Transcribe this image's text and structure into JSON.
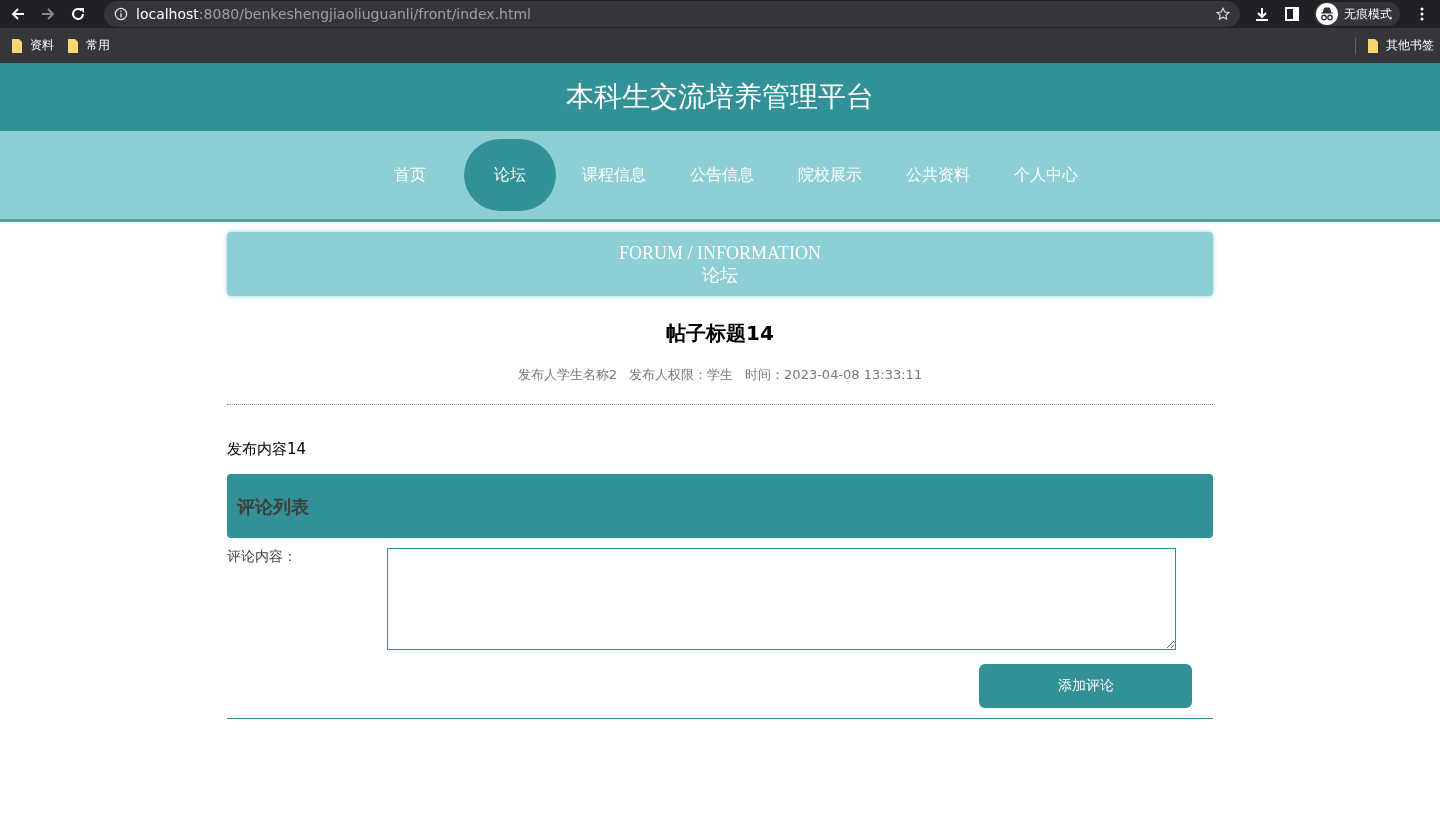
{
  "browser": {
    "url_host": "localhost",
    "url_path": ":8080/benkeshengjiaoliuguanli/front/index.html",
    "profile_label": "无痕模式",
    "bookmarks": [
      "资料",
      "常用"
    ],
    "other_bookmarks": "其他书签"
  },
  "site": {
    "title": "本科生交流培养管理平台"
  },
  "nav": [
    {
      "label": "首页",
      "selected": false
    },
    {
      "label": "论坛",
      "selected": true
    },
    {
      "label": "课程信息",
      "selected": false
    },
    {
      "label": "公告信息",
      "selected": false
    },
    {
      "label": "院校展示",
      "selected": false
    },
    {
      "label": "公共资料",
      "selected": false
    },
    {
      "label": "个人中心",
      "selected": false
    }
  ],
  "banner": {
    "subtitle_en": "FORUM / INFORMATION",
    "title": "论坛"
  },
  "post": {
    "title": "帖子标题14",
    "author": "发布人学生名称2",
    "role": "发布人权限：学生",
    "time": "时间：2023-04-08 13:33:11",
    "content": "发布内容14"
  },
  "comments": {
    "heading": "评论列表",
    "field_label": "评论内容：",
    "submit": "添加评论"
  }
}
